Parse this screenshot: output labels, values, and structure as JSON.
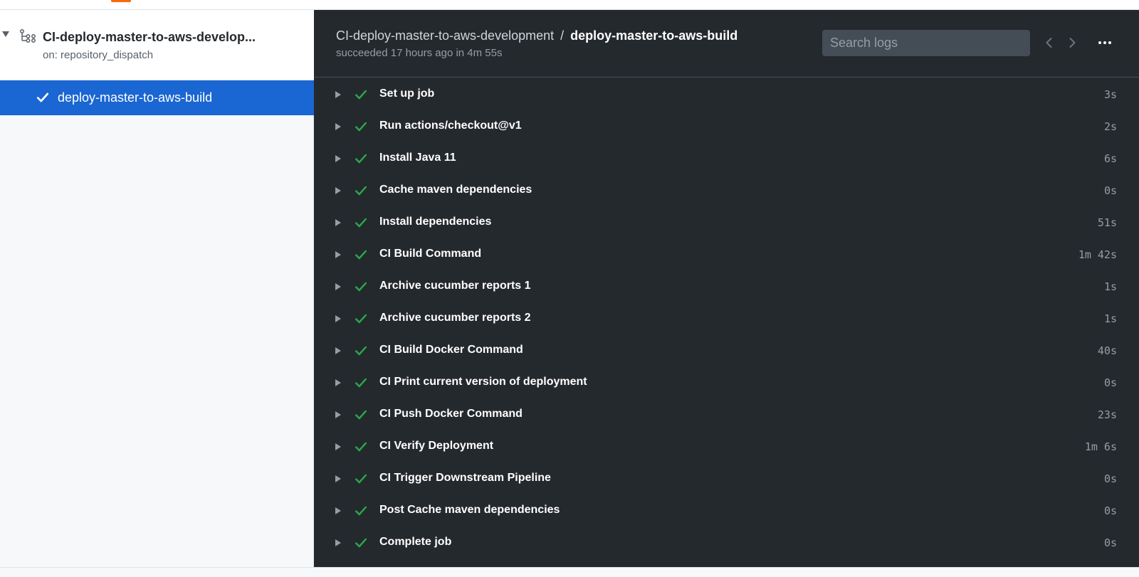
{
  "colors": {
    "accent": "#1a66d2",
    "success": "#28a745",
    "dark_bg": "#24292e"
  },
  "sidebar": {
    "workflow_title": "CI-deploy-master-to-aws-develop...",
    "workflow_trigger": "on: repository_dispatch",
    "job": {
      "label": "deploy-master-to-aws-build",
      "icon": "check-icon"
    }
  },
  "header": {
    "workflow_name": "CI-deploy-master-to-aws-development",
    "separator": "/",
    "job_name": "deploy-master-to-aws-build",
    "status": "succeeded 17 hours ago in 4m 55s",
    "search_placeholder": "Search logs"
  },
  "steps": [
    {
      "name": "Set up job",
      "duration": "3s"
    },
    {
      "name": "Run actions/checkout@v1",
      "duration": "2s"
    },
    {
      "name": "Install Java 11",
      "duration": "6s"
    },
    {
      "name": "Cache maven dependencies",
      "duration": "0s"
    },
    {
      "name": "Install dependencies",
      "duration": "51s"
    },
    {
      "name": "CI Build Command",
      "duration": "1m 42s"
    },
    {
      "name": "Archive cucumber reports 1",
      "duration": "1s"
    },
    {
      "name": "Archive cucumber reports 2",
      "duration": "1s"
    },
    {
      "name": "CI Build Docker Command",
      "duration": "40s"
    },
    {
      "name": "CI Print current version of deployment",
      "duration": "0s"
    },
    {
      "name": "CI Push Docker Command",
      "duration": "23s"
    },
    {
      "name": "CI Verify Deployment",
      "duration": "1m 6s"
    },
    {
      "name": "CI Trigger Downstream Pipeline",
      "duration": "0s"
    },
    {
      "name": "Post Cache maven dependencies",
      "duration": "0s"
    },
    {
      "name": "Complete job",
      "duration": "0s"
    }
  ]
}
